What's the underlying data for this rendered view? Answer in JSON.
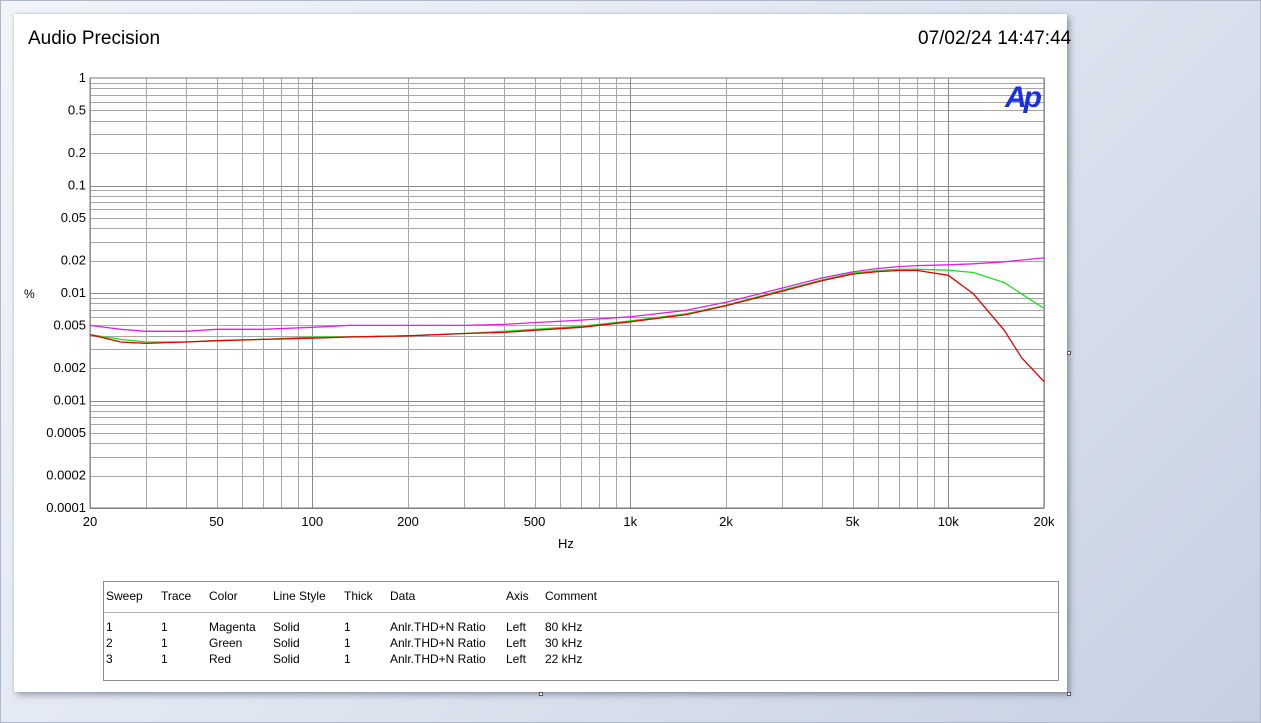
{
  "header": {
    "app_title": "Audio Precision",
    "timestamp": "07/02/24 14:47:44",
    "logo_text": "Ap"
  },
  "chart_data": {
    "type": "line",
    "xlabel": "Hz",
    "ylabel": "%",
    "x_scale": "log",
    "y_scale": "log",
    "xlim": [
      20,
      20000
    ],
    "ylim": [
      0.0001,
      1
    ],
    "grid": true,
    "x_ticks": [
      {
        "v": 20,
        "label": "20"
      },
      {
        "v": 50,
        "label": "50"
      },
      {
        "v": 100,
        "label": "100"
      },
      {
        "v": 200,
        "label": "200"
      },
      {
        "v": 500,
        "label": "500"
      },
      {
        "v": 1000,
        "label": "1k"
      },
      {
        "v": 2000,
        "label": "2k"
      },
      {
        "v": 5000,
        "label": "5k"
      },
      {
        "v": 10000,
        "label": "10k"
      },
      {
        "v": 20000,
        "label": "20k"
      }
    ],
    "y_ticks": [
      {
        "v": 1,
        "label": "1"
      },
      {
        "v": 0.5,
        "label": "0.5"
      },
      {
        "v": 0.2,
        "label": "0.2"
      },
      {
        "v": 0.1,
        "label": "0.1"
      },
      {
        "v": 0.05,
        "label": "0.05"
      },
      {
        "v": 0.02,
        "label": "0.02"
      },
      {
        "v": 0.01,
        "label": "0.01"
      },
      {
        "v": 0.005,
        "label": "0.005"
      },
      {
        "v": 0.002,
        "label": "0.002"
      },
      {
        "v": 0.001,
        "label": "0.001"
      },
      {
        "v": 0.0005,
        "label": "0.0005"
      },
      {
        "v": 0.0002,
        "label": "0.0002"
      },
      {
        "v": 0.0001,
        "label": "0.0001"
      }
    ],
    "series": [
      {
        "color": "#e020e0",
        "x": [
          20,
          25,
          30,
          40,
          50,
          70,
          100,
          130,
          200,
          300,
          400,
          500,
          700,
          1000,
          1500,
          2000,
          3000,
          4000,
          5000,
          6000,
          7000,
          8000,
          10000,
          12000,
          15000,
          20000
        ],
        "y": [
          0.005,
          0.0046,
          0.0044,
          0.0044,
          0.0046,
          0.0046,
          0.0048,
          0.005,
          0.005,
          0.005,
          0.0051,
          0.0053,
          0.0056,
          0.006,
          0.0069,
          0.0082,
          0.0111,
          0.0138,
          0.0157,
          0.0169,
          0.0176,
          0.018,
          0.0183,
          0.0187,
          0.0195,
          0.0212
        ]
      },
      {
        "color": "#22dd22",
        "x": [
          20,
          25,
          30,
          40,
          50,
          70,
          100,
          130,
          200,
          300,
          400,
          500,
          700,
          1000,
          1500,
          2000,
          3000,
          4000,
          5000,
          6000,
          7000,
          8000,
          10000,
          12000,
          15000,
          17000,
          20000
        ],
        "y": [
          0.0041,
          0.0037,
          0.0035,
          0.0035,
          0.0036,
          0.0037,
          0.0039,
          0.0039,
          0.004,
          0.0042,
          0.0044,
          0.0046,
          0.0049,
          0.0055,
          0.0064,
          0.0077,
          0.0106,
          0.0132,
          0.0153,
          0.0162,
          0.0166,
          0.0166,
          0.0163,
          0.0155,
          0.0125,
          0.0098,
          0.0072
        ]
      },
      {
        "color": "#e00000",
        "x": [
          20,
          25,
          30,
          40,
          50,
          70,
          100,
          130,
          200,
          300,
          400,
          500,
          700,
          1000,
          1500,
          2000,
          3000,
          4000,
          5000,
          6000,
          7000,
          8000,
          10000,
          12000,
          15000,
          17000,
          20000
        ],
        "y": [
          0.0041,
          0.0035,
          0.0034,
          0.0035,
          0.0036,
          0.0037,
          0.0038,
          0.0039,
          0.004,
          0.0042,
          0.0043,
          0.0045,
          0.0048,
          0.0054,
          0.0063,
          0.0076,
          0.0104,
          0.013,
          0.015,
          0.0158,
          0.0162,
          0.0162,
          0.0146,
          0.0098,
          0.0045,
          0.0025,
          0.0015
        ]
      }
    ]
  },
  "legend": {
    "headers": [
      "Sweep",
      "Trace",
      "Color",
      "Line Style",
      "Thick",
      "Data",
      "Axis",
      "Comment"
    ],
    "rows": [
      [
        "1",
        "1",
        "Magenta",
        "Solid",
        "1",
        "Anlr.THD+N Ratio",
        "Left",
        "80 kHz"
      ],
      [
        "2",
        "1",
        "Green",
        "Solid",
        "1",
        "Anlr.THD+N Ratio",
        "Left",
        "30 kHz"
      ],
      [
        "3",
        "1",
        "Red",
        "Solid",
        "1",
        "Anlr.THD+N Ratio",
        "Left",
        "22 kHz"
      ]
    ]
  }
}
